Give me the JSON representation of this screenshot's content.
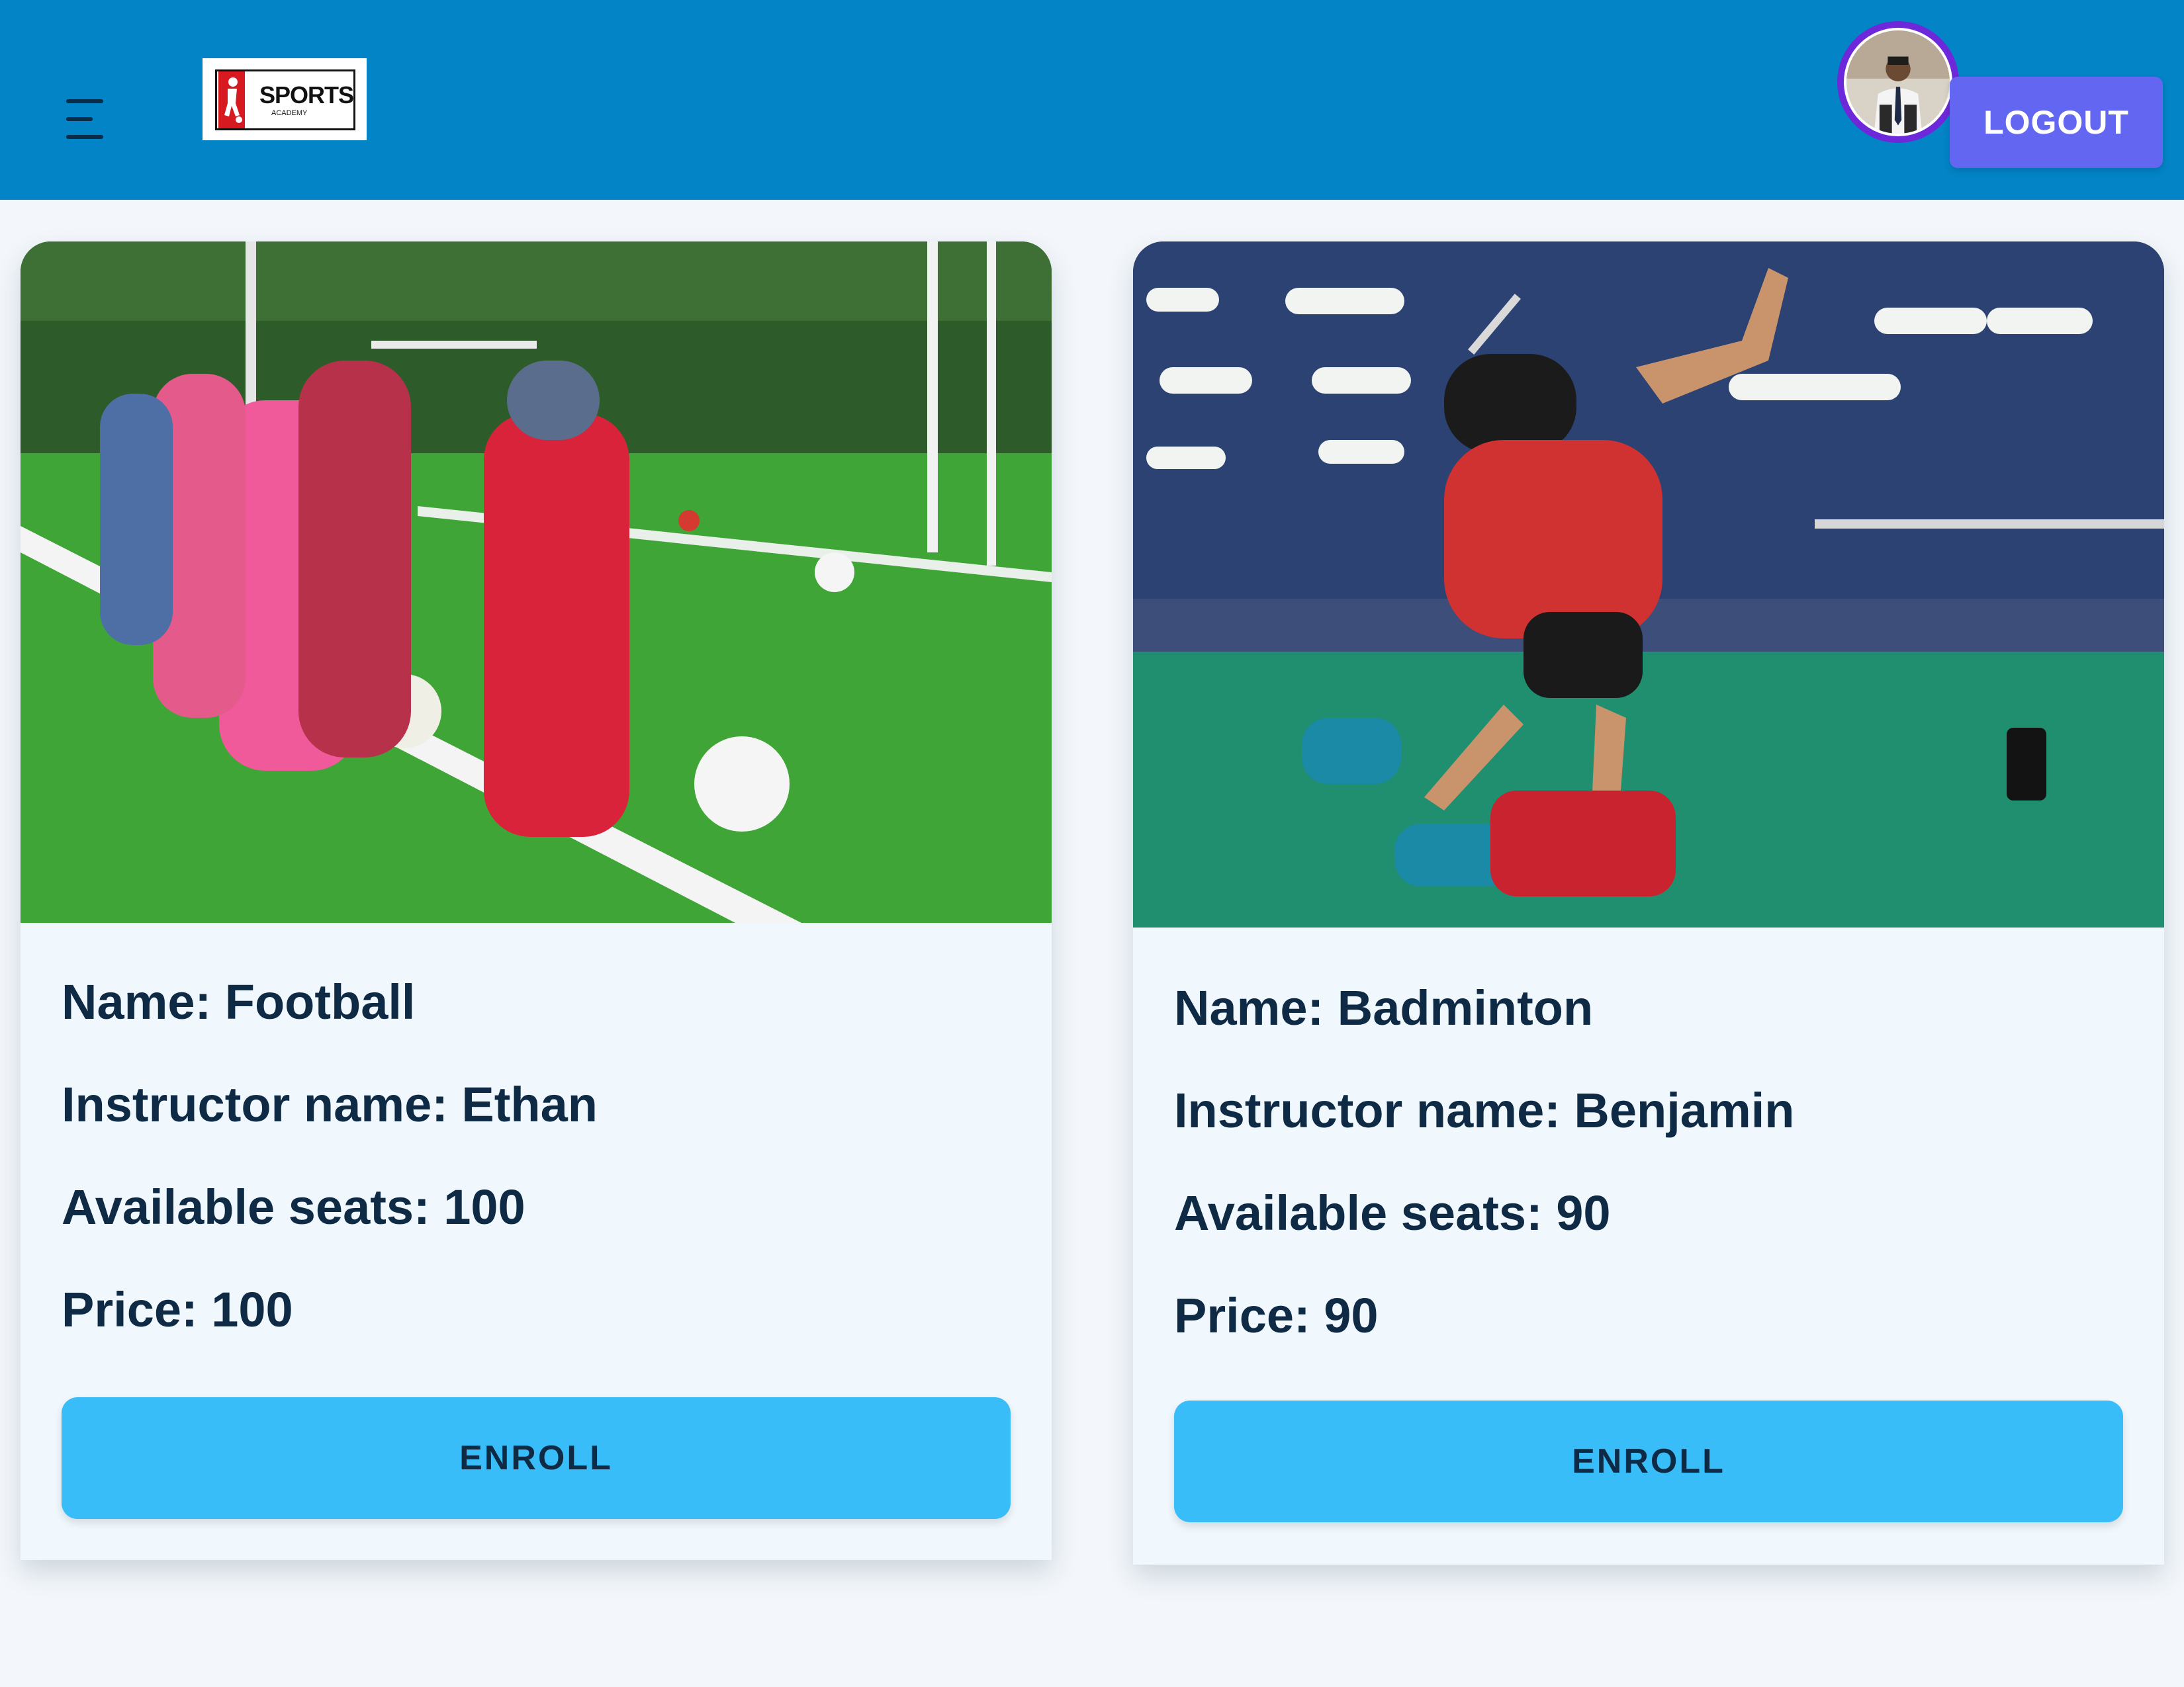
{
  "header": {
    "menu_icon": "hamburger-menu-icon",
    "logo": {
      "primary": "SPORTS",
      "secondary": "ACADEMY"
    },
    "avatar_icon": "user-avatar",
    "logout_label": "LOGOUT",
    "colors": {
      "bar": "#0284c7",
      "logout": "#6366f1",
      "avatar_ring": "#6d28d9"
    }
  },
  "classes": [
    {
      "image_subject": "children kicking footballs on a grass field",
      "name_line": "Name: Football",
      "instructor_line": "Instructor name: Ethan",
      "seats_line": "Available seats: 100",
      "price_line": "Price: 100",
      "enroll_label": "ENROLL"
    },
    {
      "image_subject": "boy jumping to hit a badminton shuttlecock in an indoor hall",
      "name_line": "Name: Badminton",
      "instructor_line": "Instructor name: Benjamin",
      "seats_line": "Available seats: 90",
      "price_line": "Price: 90",
      "enroll_label": "ENROLL"
    }
  ],
  "colors": {
    "enroll_button": "#38bdf8",
    "card_background": "#f0f8fe",
    "page_background": "#f3f7fb"
  }
}
